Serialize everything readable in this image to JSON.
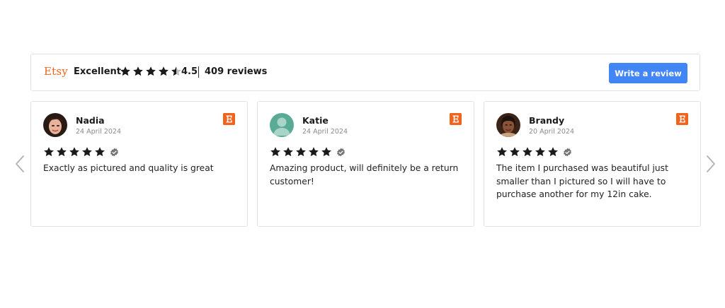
{
  "summary": {
    "brand": "Etsy",
    "rating_word": "Excellent",
    "rating": "4.5",
    "reviews_count": "409 reviews",
    "write_button": "Write a review",
    "star_fill": 4.5
  },
  "nav": {
    "prev_icon": "chevron-left-icon",
    "next_icon": "chevron-right-icon"
  },
  "reviews": [
    {
      "name": "Nadia",
      "date": "24 April 2024",
      "stars": 5,
      "text": "Exactly as pictured and quality is great",
      "avatar": "photo"
    },
    {
      "name": "Katie",
      "date": "24 April 2024",
      "stars": 5,
      "text": "Amazing product, will definitely be a return customer!",
      "avatar": "default"
    },
    {
      "name": "Brandy",
      "date": "20 April 2024",
      "stars": 5,
      "text": "The item I purchased was beautiful just smaller than I pictured so I will have to purchase another for my 12in cake.",
      "avatar": "photo"
    }
  ],
  "colors": {
    "brand": "#f1641e",
    "button": "#4285f4",
    "star": "#1a1a1a",
    "verified": "#757575"
  }
}
